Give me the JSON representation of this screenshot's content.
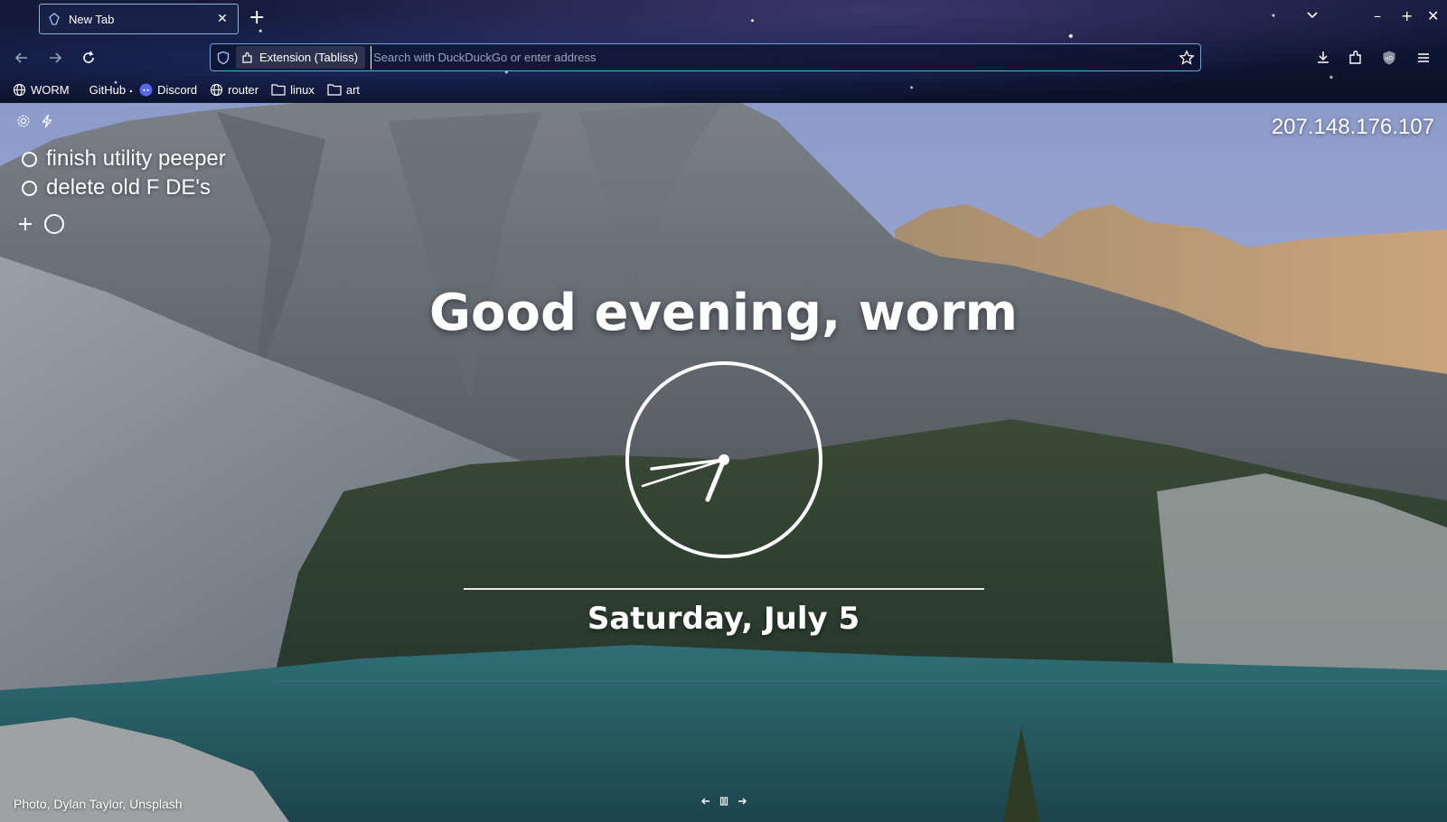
{
  "browser": {
    "tab": {
      "title": "New Tab",
      "close_glyph": "✕"
    },
    "new_tab_glyph": "+",
    "window_controls": {
      "list_tabs": "⌄",
      "minimize": "–",
      "maximize": "+",
      "close": "✕"
    },
    "urlbar": {
      "identity_label": "Extension (Tabliss)",
      "placeholder": "Search with DuckDuckGo or enter address",
      "value": ""
    },
    "bookmarks": [
      {
        "label": "WORM",
        "icon": "globe-icon"
      },
      {
        "label": "GitHub",
        "icon": "github-icon"
      },
      {
        "label": "Discord",
        "icon": "discord-icon"
      },
      {
        "label": "router",
        "icon": "globe-icon"
      },
      {
        "label": "linux",
        "icon": "folder-icon"
      },
      {
        "label": "art",
        "icon": "folder-icon"
      }
    ]
  },
  "tabliss": {
    "ip_address": "207.148.176.107",
    "todos": [
      {
        "text": "finish utility peeper",
        "done": false
      },
      {
        "text": "delete old F DE's",
        "done": false
      }
    ],
    "greeting": "Good evening, worm",
    "clock": {
      "type": "analog"
    },
    "date": "Saturday, July 5",
    "credit": {
      "prefix": "Photo",
      "author": "Dylan Taylor",
      "source": "Unsplash"
    },
    "background_controls": [
      "previous-icon",
      "pause-icon",
      "next-icon"
    ]
  },
  "colors": {
    "urlbar_border": "#5fa8e0",
    "tab_border": "#8fb1d6",
    "text": "#ffffff",
    "lake": "#2c6a72"
  }
}
